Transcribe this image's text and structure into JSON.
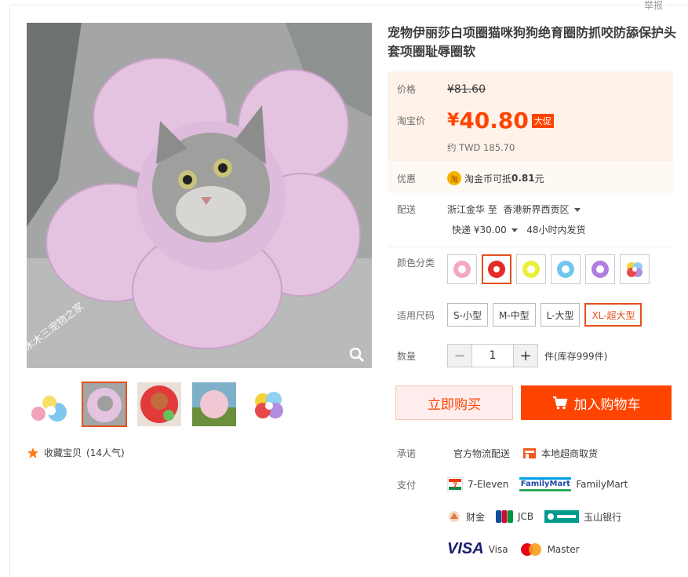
{
  "report_label": "举报",
  "product": {
    "title": "宠物伊丽莎白项圈猫咪狗狗绝育圈防抓咬防舔保护头套项圈耻辱圈软",
    "watermark": "木木三宠物之家"
  },
  "price": {
    "label": "价格",
    "old": "¥81.60",
    "taobao_label": "淘宝价",
    "symbol": "¥",
    "current": "40.80",
    "promo": "大促",
    "approx": "约 TWD 185.70"
  },
  "coupon": {
    "label": "优惠",
    "coin_icon": "淘",
    "text_prefix": "淘金币可抵",
    "amount": "0.81",
    "unit": "元"
  },
  "shipping": {
    "label": "配送",
    "from": "浙江金华",
    "to_word": "至",
    "dest": "香港新界西贡区",
    "method": "快递 ¥30.00",
    "time": "48小时内发货"
  },
  "color": {
    "label": "颜色分类",
    "options": [
      "pink",
      "red",
      "yellow",
      "blue",
      "purple",
      "rainbow"
    ],
    "selected_index": 1
  },
  "size": {
    "label": "适用尺码",
    "options": [
      "S-小型",
      "M-中型",
      "L-大型",
      "XL-超大型"
    ],
    "selected_index": 3
  },
  "quantity": {
    "label": "数量",
    "value": "1",
    "stock": "件(库存999件)"
  },
  "actions": {
    "buy_now": "立即购买",
    "add_cart": "加入购物车"
  },
  "favorite": {
    "label": "收藏宝贝",
    "count": "(14人气)"
  },
  "promise": {
    "label": "承诺",
    "items": [
      "官方物流配送",
      "本地超商取货"
    ]
  },
  "payment": {
    "label": "支付",
    "seven": "7-Eleven",
    "familymart_logo": "FamilyMart",
    "familymart": "FamilyMart",
    "caijin": "财金",
    "jcb": "JCB",
    "esun": "玉山银行",
    "visa_logo": "VISA",
    "visa": "Visa",
    "master": "Master"
  },
  "colors": {
    "accent": "#ff4400",
    "price_bg": "#fff2e8",
    "selected_border": "#e4501d"
  }
}
